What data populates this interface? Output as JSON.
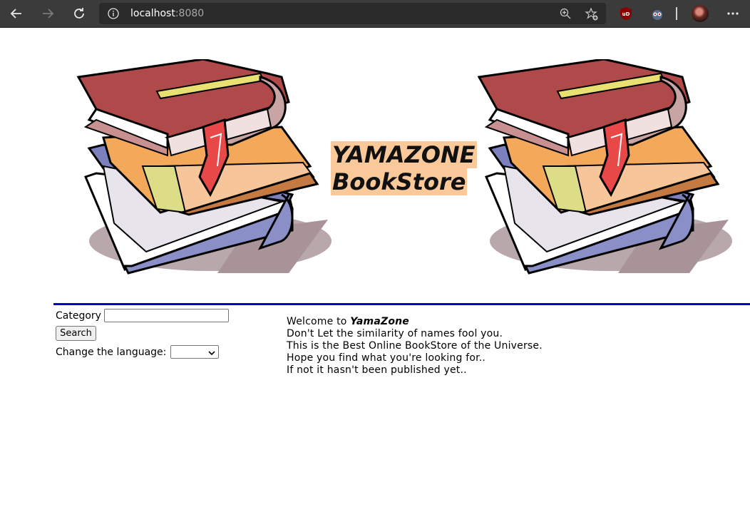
{
  "browser": {
    "url_host": "localhost",
    "url_port": ":8080",
    "colors": {
      "chrome_bg": "#3b3b3b",
      "address_bg": "#2a2a2a"
    }
  },
  "header": {
    "title_line1": "YAMAZONE",
    "title_line2": "BookStore",
    "title_bg": "#f9c99a"
  },
  "sidebar": {
    "category_label": "Category",
    "category_value": "",
    "search_label": "Search",
    "language_label": "Change the language:",
    "language_value": ""
  },
  "welcome": {
    "line1_prefix": "Welcome to ",
    "line1_brand": "YamaZone",
    "line2": "Don't Let the similarity of names fool you.",
    "line3": "This is the Best Online BookStore of the Universe.",
    "line4": "Hope you find what you're looking for..",
    "line5": "If not it hasn't been published yet.."
  },
  "icons": [
    "back-icon",
    "forward-icon",
    "refresh-icon",
    "info-icon",
    "zoom-icon",
    "favorite-icon",
    "ublock-icon",
    "extension-icon",
    "profile-avatar",
    "more-icon",
    "books-clipart"
  ],
  "accent_rule_color": "#0000cc"
}
